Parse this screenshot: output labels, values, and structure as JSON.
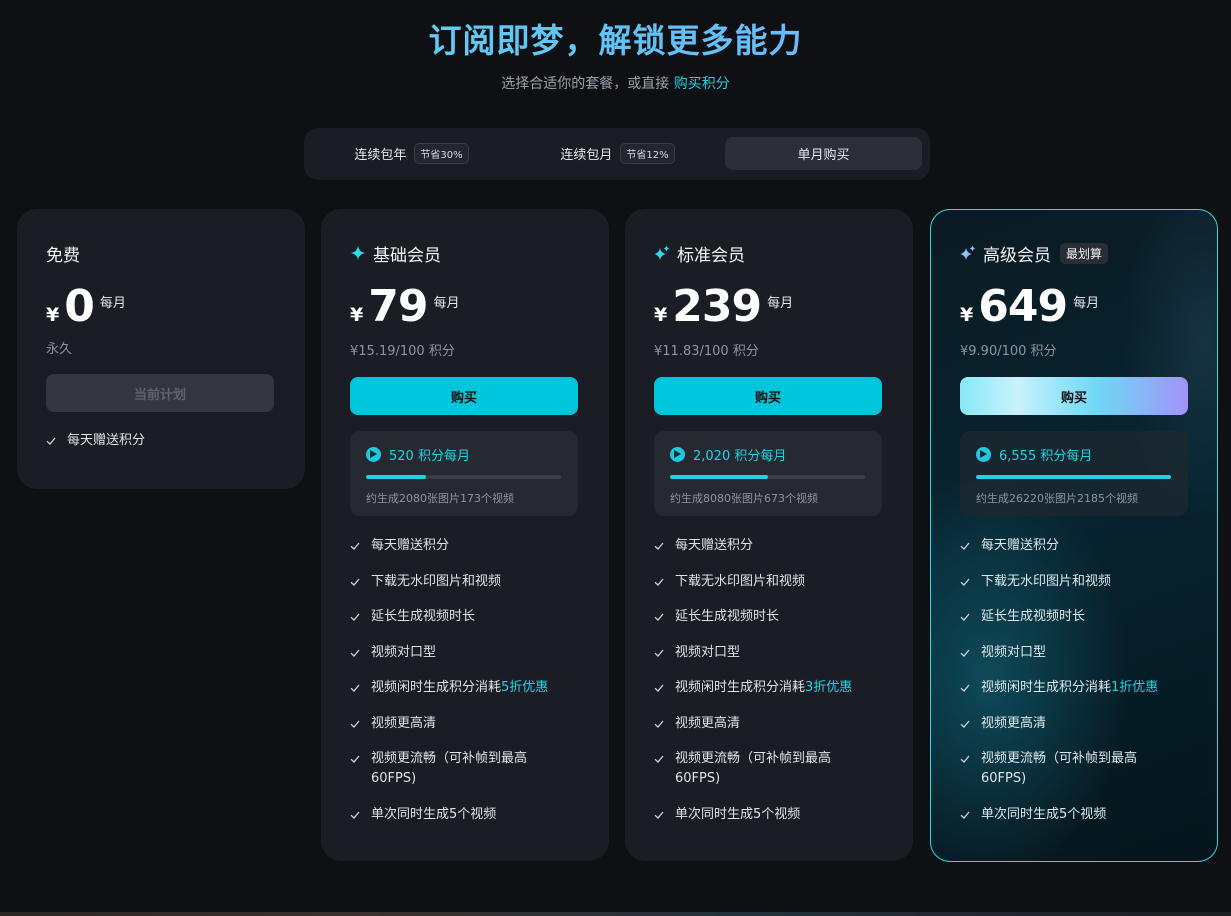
{
  "header": {
    "title": "订阅即梦，解锁更多能力",
    "subtitle_prefix": "选择合适你的套餐，或直接 ",
    "subtitle_link": "购买积分"
  },
  "tabs": [
    {
      "label": "连续包年",
      "save": "节省30%",
      "active": false
    },
    {
      "label": "连续包月",
      "save": "节省12%",
      "active": false
    },
    {
      "label": "单月购买",
      "save": "",
      "active": true
    }
  ],
  "currency_symbol": "¥",
  "per_label": "每月",
  "accent_color": "#1fd3e4",
  "plans": {
    "free": {
      "name": "免费",
      "price": "0",
      "period": "永久",
      "button": "当前计划",
      "features": [
        "每天赠送积分"
      ]
    },
    "basic": {
      "name": "基础会员",
      "icon": "sparkle-icon",
      "price": "79",
      "unit_price": "¥15.19/100 积分",
      "button": "购买",
      "credits": "520 积分每月",
      "credits_fill": 0.31,
      "credits_desc": "约生成2080张图片173个视频",
      "features": [
        "每天赠送积分",
        "下载无水印图片和视频",
        "延长生成视频时长",
        "视频对口型"
      ],
      "feature_idle_prefix": "视频闲时生成积分消耗",
      "feature_idle_highlight": "5折优惠",
      "features_after": [
        "视频更高清",
        "视频更流畅（可补帧到最高60FPS)",
        "单次同时生成5个视频"
      ]
    },
    "std": {
      "name": "标准会员",
      "icon": "sparkles-icon",
      "price": "239",
      "unit_price": "¥11.83/100 积分",
      "button": "购买",
      "credits": "2,020 积分每月",
      "credits_fill": 0.5,
      "credits_desc": "约生成8080张图片673个视频",
      "features": [
        "每天赠送积分",
        "下载无水印图片和视频",
        "延长生成视频时长",
        "视频对口型"
      ],
      "feature_idle_prefix": "视频闲时生成积分消耗",
      "feature_idle_highlight": "3折优惠",
      "features_after": [
        "视频更高清",
        "视频更流畅（可补帧到最高60FPS)",
        "单次同时生成5个视频"
      ]
    },
    "pro": {
      "name": "高级会员",
      "icon": "sparkles-icon",
      "badge": "最划算",
      "price": "649",
      "unit_price": "¥9.90/100 积分",
      "button": "购买",
      "credits": "6,555 积分每月",
      "credits_fill": 1.0,
      "credits_desc": "约生成26220张图片2185个视频",
      "features": [
        "每天赠送积分",
        "下载无水印图片和视频",
        "延长生成视频时长",
        "视频对口型"
      ],
      "feature_idle_prefix": "视频闲时生成积分消耗",
      "feature_idle_highlight": "1折优惠",
      "features_after": [
        "视频更高清",
        "视频更流畅（可补帧到最高60FPS)",
        "单次同时生成5个视频"
      ]
    }
  }
}
